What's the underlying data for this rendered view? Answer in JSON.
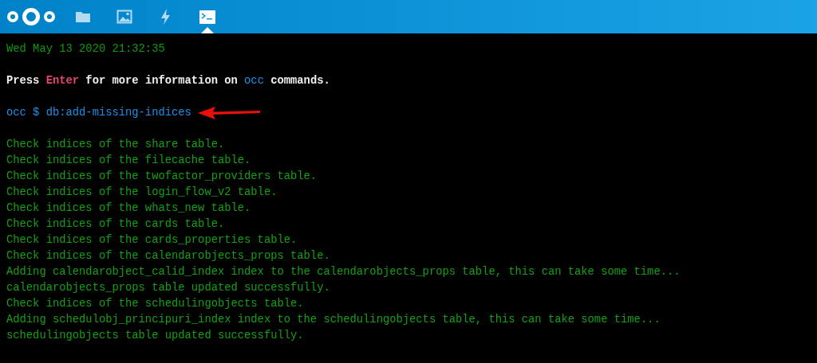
{
  "nav": [
    {
      "kind": "files",
      "selected": false
    },
    {
      "kind": "photos",
      "selected": false
    },
    {
      "kind": "activity",
      "selected": false
    },
    {
      "kind": "terminal",
      "selected": true
    }
  ],
  "terminal": {
    "lines": [
      {
        "segments": [
          {
            "kind": "date",
            "text": "Wed May 13 2020 21:32:35"
          }
        ]
      },
      {
        "segments": [
          {
            "kind": "plain",
            "text": "Press "
          },
          {
            "kind": "key",
            "text": "Enter"
          },
          {
            "kind": "plain",
            "text": " for more information on "
          },
          {
            "kind": "command",
            "text": "occ"
          },
          {
            "kind": "plain",
            "text": " commands."
          }
        ]
      },
      {
        "arrow": true,
        "segments": [
          {
            "kind": "command",
            "text": "occ $ db:add-missing-indices"
          }
        ]
      },
      {
        "segments": [
          {
            "kind": "output",
            "text": "Check indices of the share table."
          }
        ]
      },
      {
        "segments": [
          {
            "kind": "output",
            "text": "Check indices of the filecache table."
          }
        ]
      },
      {
        "segments": [
          {
            "kind": "output",
            "text": "Check indices of the twofactor_providers table."
          }
        ]
      },
      {
        "segments": [
          {
            "kind": "output",
            "text": "Check indices of the login_flow_v2 table."
          }
        ]
      },
      {
        "segments": [
          {
            "kind": "output",
            "text": "Check indices of the whats_new table."
          }
        ]
      },
      {
        "segments": [
          {
            "kind": "output",
            "text": "Check indices of the cards table."
          }
        ]
      },
      {
        "segments": [
          {
            "kind": "output",
            "text": "Check indices of the cards_properties table."
          }
        ]
      },
      {
        "segments": [
          {
            "kind": "output",
            "text": "Check indices of the calendarobjects_props table."
          }
        ]
      },
      {
        "segments": [
          {
            "kind": "output",
            "text": "Adding calendarobject_calid_index index to the calendarobjects_props table, this can take some time..."
          }
        ]
      },
      {
        "segments": [
          {
            "kind": "output",
            "text": "calendarobjects_props table updated successfully."
          }
        ]
      },
      {
        "segments": [
          {
            "kind": "output",
            "text": "Check indices of the schedulingobjects table."
          }
        ]
      },
      {
        "segments": [
          {
            "kind": "output",
            "text": "Adding schedulobj_principuri_index index to the schedulingobjects table, this can take some time..."
          }
        ]
      },
      {
        "segments": [
          {
            "kind": "output",
            "text": "schedulingobjects table updated successfully."
          }
        ]
      }
    ]
  }
}
